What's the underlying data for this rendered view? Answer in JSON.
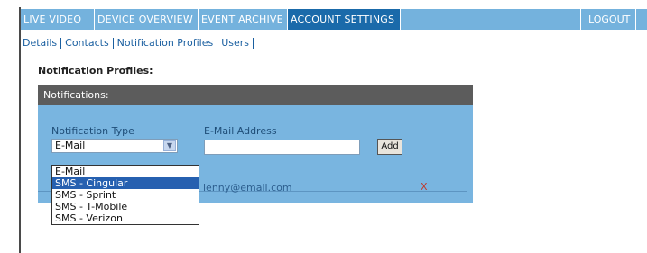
{
  "topnav": {
    "tabs": [
      {
        "label": "LIVE VIDEO"
      },
      {
        "label": "DEVICE OVERVIEW"
      },
      {
        "label": "EVENT ARCHIVE"
      },
      {
        "label": "ACCOUNT SETTINGS",
        "active": true
      }
    ],
    "logout": "LOGOUT"
  },
  "subnav": {
    "items": [
      "Details",
      "Contacts",
      "Notification Profiles",
      "Users"
    ],
    "active": "Notification Profiles"
  },
  "page": {
    "heading": "Notification Profiles:"
  },
  "panel": {
    "title": "Notifications:",
    "type_label": "Notification Type",
    "email_label": "E-Mail Address",
    "selected_type": "E-Mail",
    "email_value": "",
    "add_label": "Add",
    "dropdown_options": [
      "E-Mail",
      "SMS - Cingular",
      "SMS - Sprint",
      "SMS - T-Mobile",
      "SMS - Verizon"
    ],
    "highlighted_option": "SMS - Cingular",
    "entries": [
      {
        "email": "lenny@email.com",
        "delete": "X"
      }
    ]
  },
  "colors": {
    "nav_bg": "#74b2dd",
    "nav_active": "#1a6aaa",
    "panel_bg": "#79b5e0",
    "panel_header": "#5c5c5c",
    "selection": "#2660b0"
  }
}
